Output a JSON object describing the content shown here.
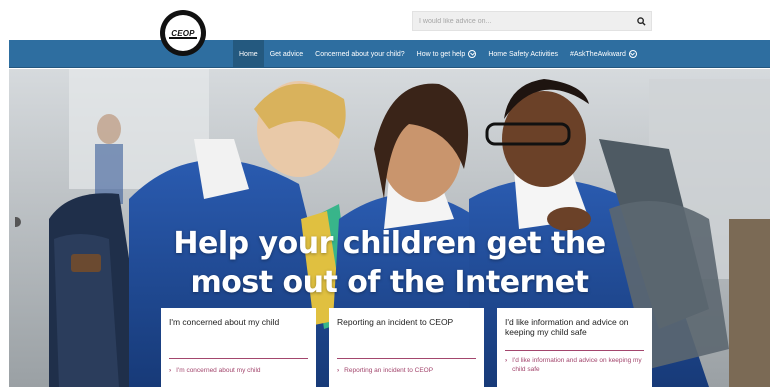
{
  "brand": {
    "logo_text": "CEOP"
  },
  "search": {
    "placeholder": "I would like advice on...",
    "icon": "search-icon"
  },
  "nav": {
    "items": [
      {
        "label": "Home",
        "active": true
      },
      {
        "label": "Get advice",
        "active": false
      },
      {
        "label": "Concerned about your child?",
        "active": false
      },
      {
        "label": "How to get help",
        "active": false,
        "dropdown": true
      },
      {
        "label": "Home Safety Activities",
        "active": false
      },
      {
        "label": "#AskTheAwkward",
        "active": false,
        "dropdown": true
      }
    ]
  },
  "hero": {
    "headline_line1": "Help your children get the",
    "headline_line2": "most out of the Internet"
  },
  "cards": [
    {
      "title": "I'm concerned about my child",
      "link": "I'm concerned about my child"
    },
    {
      "title": "Reporting an incident to CEOP",
      "link": "Reporting an incident to CEOP"
    },
    {
      "title": "I'd like information and advice on keeping my child safe",
      "link": "I'd like information and advice on keeping my child safe"
    }
  ],
  "colors": {
    "nav_bg": "#2e6ea0",
    "accent": "#a3466d",
    "uniform_blue": "#1f4d9c"
  }
}
